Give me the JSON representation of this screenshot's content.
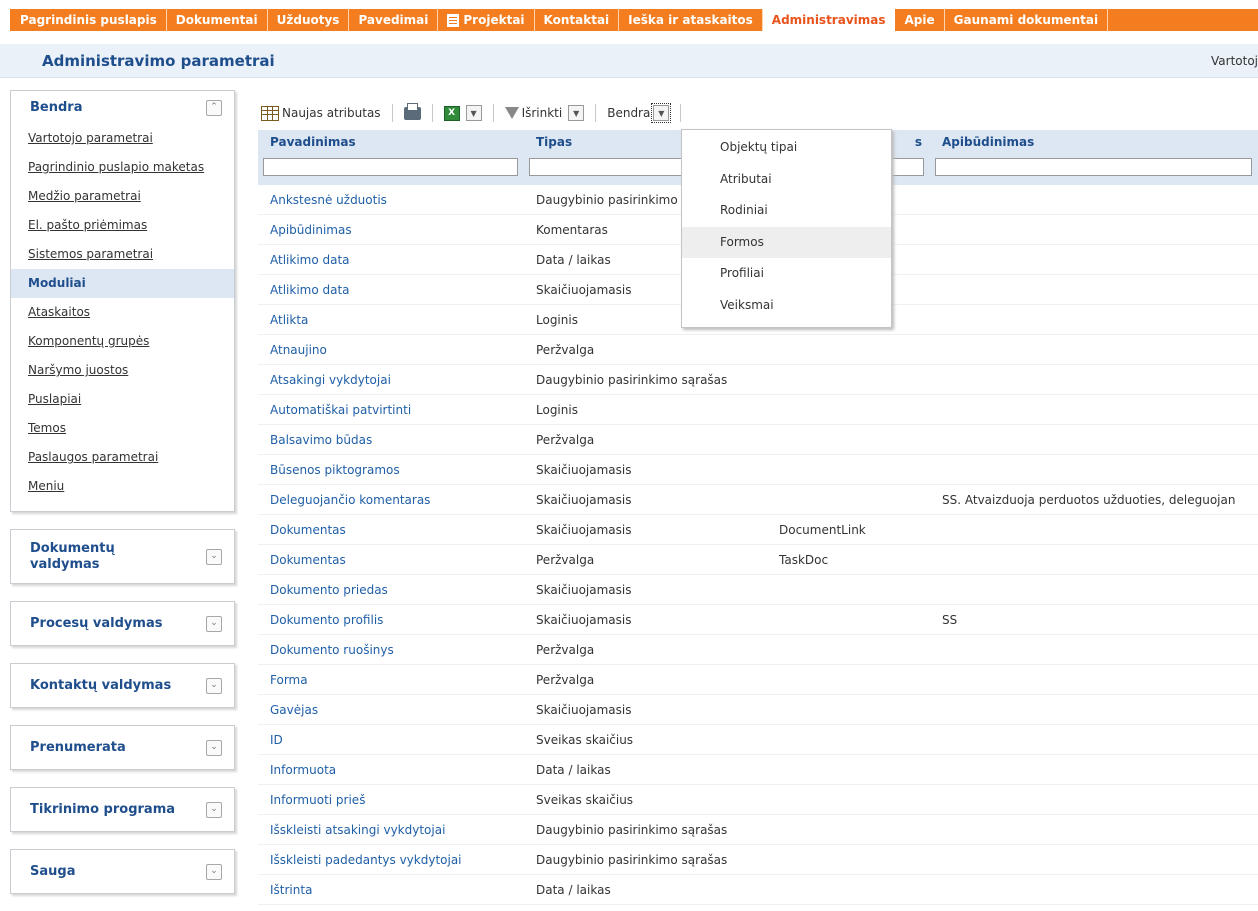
{
  "topnav": {
    "items": [
      "Pagrindinis puslapis",
      "Dokumentai",
      "Užduotys",
      "Pavedimai",
      "Projektai",
      "Kontaktai",
      "Ieška ir ataskaitos",
      "Administravimas",
      "Apie",
      "Gaunami dokumentai"
    ],
    "active": "Administravimas"
  },
  "header": {
    "title": "Administravimo parametrai",
    "user": "Vartotoj"
  },
  "sidebar": {
    "bendra": {
      "title": "Bendra",
      "items": [
        "Vartotojo parametrai",
        "Pagrindinio puslapio maketas",
        "Medžio parametrai",
        "El. pašto priėmimas",
        "Sistemos parametrai",
        "Moduliai",
        "Ataskaitos",
        "Komponentų grupės",
        "Naršymo juostos",
        "Puslapiai",
        "Temos",
        "Paslaugos parametrai",
        "Meniu"
      ],
      "active": "Moduliai"
    },
    "panels": [
      "Dokumentų valdymas",
      "Procesų valdymas",
      "Kontaktų valdymas",
      "Prenumerata",
      "Tikrinimo programa",
      "Sauga"
    ]
  },
  "toolbar": {
    "new_attr": "Naujas atributas",
    "filter": "Išrinkti",
    "bendra": "Bendra"
  },
  "table": {
    "headers": [
      "Pavadinimas",
      "Tipas",
      "s",
      "Apibūdinimas"
    ],
    "rows": [
      [
        "Ankstesnė užduotis",
        "Daugybinio pasirinkimo",
        "",
        ""
      ],
      [
        "Apibūdinimas",
        "Komentaras",
        "",
        ""
      ],
      [
        "Atlikimo data",
        "Data / laikas",
        "",
        ""
      ],
      [
        "Atlikimo data",
        "Skaičiuojamasis",
        "",
        ""
      ],
      [
        "Atlikta",
        "Loginis",
        "",
        ""
      ],
      [
        "Atnaujino",
        "Peržvalga",
        "",
        ""
      ],
      [
        "Atsakingi vykdytojai",
        "Daugybinio pasirinkimo sąrašas",
        "",
        ""
      ],
      [
        "Automatiškai patvirtinti",
        "Loginis",
        "",
        ""
      ],
      [
        "Balsavimo būdas",
        "Peržvalga",
        "",
        ""
      ],
      [
        "Būsenos piktogramos",
        "Skaičiuojamasis",
        "",
        ""
      ],
      [
        "Deleguojančio komentaras",
        "Skaičiuojamasis",
        "",
        "SS. Atvaizduoja perduotos užduoties, deleguojan"
      ],
      [
        "Dokumentas",
        "Skaičiuojamasis",
        "DocumentLink",
        ""
      ],
      [
        "Dokumentas",
        "Peržvalga",
        "TaskDoc",
        ""
      ],
      [
        "Dokumento priedas",
        "Skaičiuojamasis",
        "",
        ""
      ],
      [
        "Dokumento profilis",
        "Skaičiuojamasis",
        "",
        "SS"
      ],
      [
        "Dokumento ruošinys",
        "Peržvalga",
        "",
        ""
      ],
      [
        "Forma",
        "Peržvalga",
        "",
        ""
      ],
      [
        "Gavėjas",
        "Skaičiuojamasis",
        "",
        ""
      ],
      [
        "ID",
        "Sveikas skaičius",
        "",
        ""
      ],
      [
        "Informuota",
        "Data / laikas",
        "",
        ""
      ],
      [
        "Informuoti prieš",
        "Sveikas skaičius",
        "",
        ""
      ],
      [
        "Išskleisti atsakingi vykdytojai",
        "Daugybinio pasirinkimo sąrašas",
        "",
        ""
      ],
      [
        "Išskleisti padedantys vykdytojai",
        "Daugybinio pasirinkimo sąrašas",
        "",
        ""
      ],
      [
        "Ištrinta",
        "Data / laikas",
        "",
        ""
      ]
    ]
  },
  "popup": {
    "items": [
      "Objektų tipai",
      "Atributai",
      "Rodiniai",
      "Formos",
      "Profiliai",
      "Veiksmai"
    ],
    "hovered": "Formos"
  }
}
